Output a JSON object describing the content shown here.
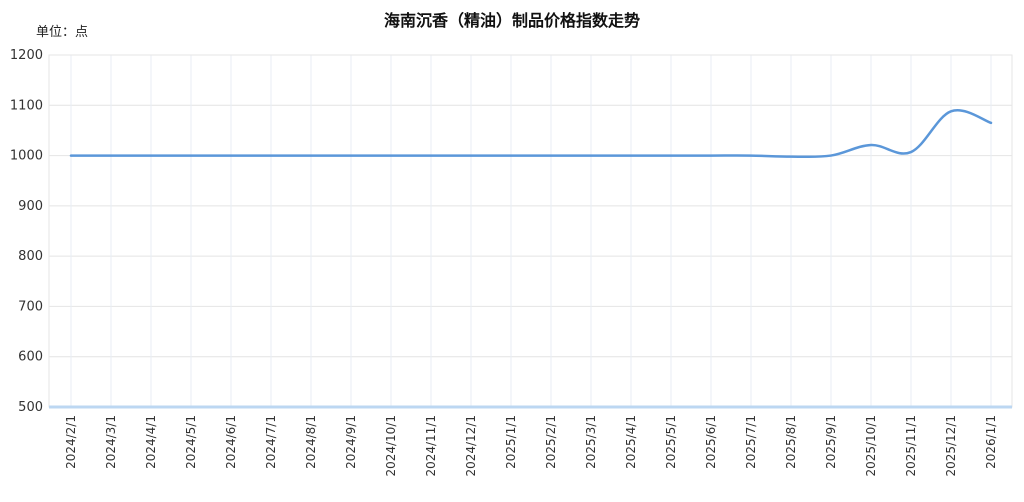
{
  "chart_data": {
    "type": "line",
    "title": "海南沉香（精油）制品价格指数走势",
    "unit_label": "单位：点",
    "xlabel": "",
    "ylabel": "",
    "ylim": [
      500,
      1200
    ],
    "y_ticks": [
      500,
      600,
      700,
      800,
      900,
      1000,
      1100,
      1200
    ],
    "grid": true,
    "legend": "none",
    "line_color": "#5b97d9",
    "categories": [
      "2024/2/1",
      "2024/3/1",
      "2024/4/1",
      "2024/5/1",
      "2024/6/1",
      "2024/7/1",
      "2024/8/1",
      "2024/9/1",
      "2024/10/1",
      "2024/11/1",
      "2024/12/1",
      "2025/1/1",
      "2025/2/1",
      "2025/3/1",
      "2025/4/1",
      "2025/5/1",
      "2025/6/1",
      "2025/7/1",
      "2025/8/1",
      "2025/9/1",
      "2025/10/1",
      "2025/11/1",
      "2025/12/1",
      "2026/1/1"
    ],
    "series": [
      {
        "values": [
          1000,
          1000,
          1000,
          1000,
          1000,
          1000,
          1000,
          1000,
          1000,
          1000,
          1000,
          1000,
          1000,
          1000,
          1000,
          1000,
          1000,
          1000,
          998,
          1000,
          1021,
          1007,
          1088,
          1065
        ]
      }
    ]
  }
}
